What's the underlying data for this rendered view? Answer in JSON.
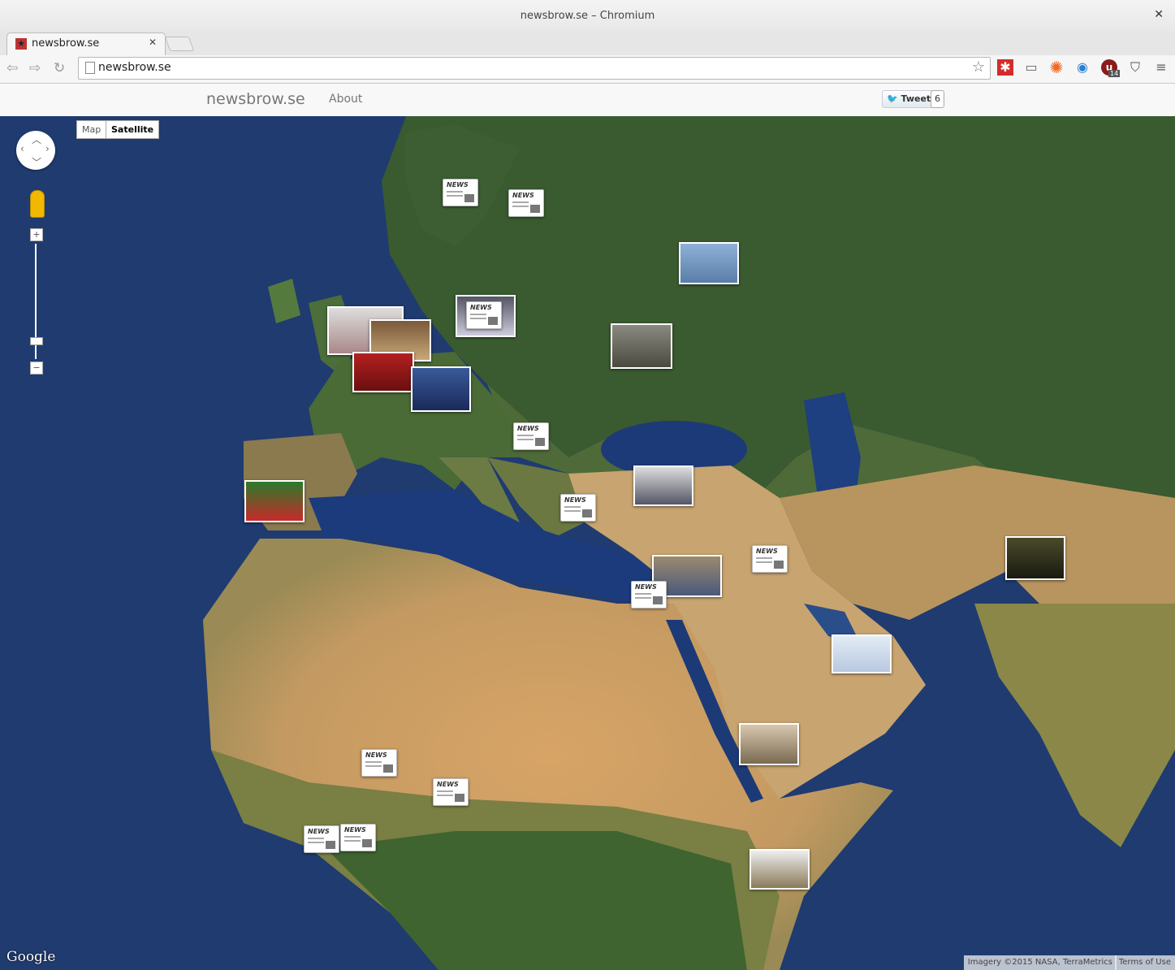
{
  "window": {
    "title": "newsbrow.se – Chromium"
  },
  "tab": {
    "label": "newsbrow.se"
  },
  "omnibox": {
    "url": "newsbrow.se"
  },
  "extensions": {
    "ublock_badge": "14"
  },
  "site": {
    "brand": "newsbrow.se",
    "about": "About",
    "tweet_label": "Tweet",
    "tweet_count": "6"
  },
  "map": {
    "type_map": "Map",
    "type_satellite": "Satellite",
    "selected_type": "Satellite",
    "news_label": "NEWS",
    "google_logo": "Google",
    "imagery": "Imagery ©2015 NASA, TerraMetrics",
    "terms": "Terms of Use"
  },
  "colors": {
    "accent_red": "#c82a2a",
    "ocean": "#1c3669",
    "land_green": "#3c5a2e",
    "desert": "#c9a068"
  }
}
